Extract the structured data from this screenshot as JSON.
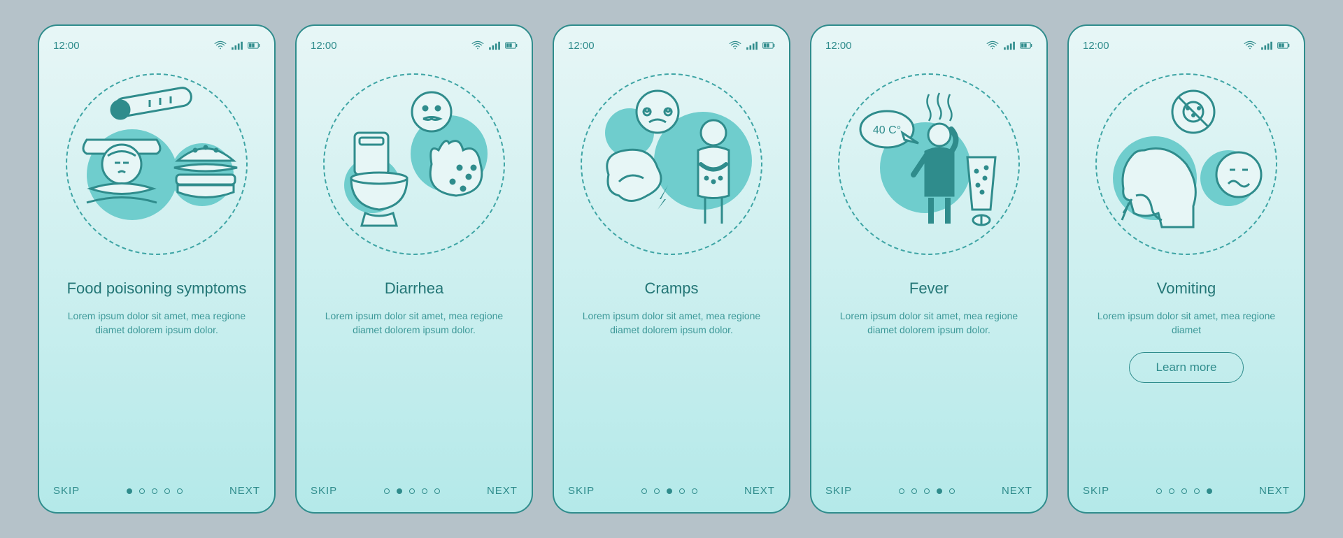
{
  "status": {
    "time": "12:00"
  },
  "nav": {
    "skip": "SKIP",
    "next": "NEXT"
  },
  "screens": [
    {
      "title": "Food poisoning symptoms",
      "body": "Lorem ipsum dolor sit amet, mea regione diamet dolorem ipsum dolor."
    },
    {
      "title": "Diarrhea",
      "body": "Lorem ipsum dolor sit amet, mea regione diamet dolorem ipsum dolor."
    },
    {
      "title": "Cramps",
      "body": "Lorem ipsum dolor sit amet, mea regione diamet dolorem ipsum dolor."
    },
    {
      "title": "Fever",
      "body": "Lorem ipsum dolor sit amet, mea regione diamet dolorem ipsum dolor.",
      "badge": "40 C°"
    },
    {
      "title": "Vomiting",
      "body": "Lorem ipsum dolor sit amet, mea regione diamet",
      "cta": "Learn more"
    }
  ]
}
